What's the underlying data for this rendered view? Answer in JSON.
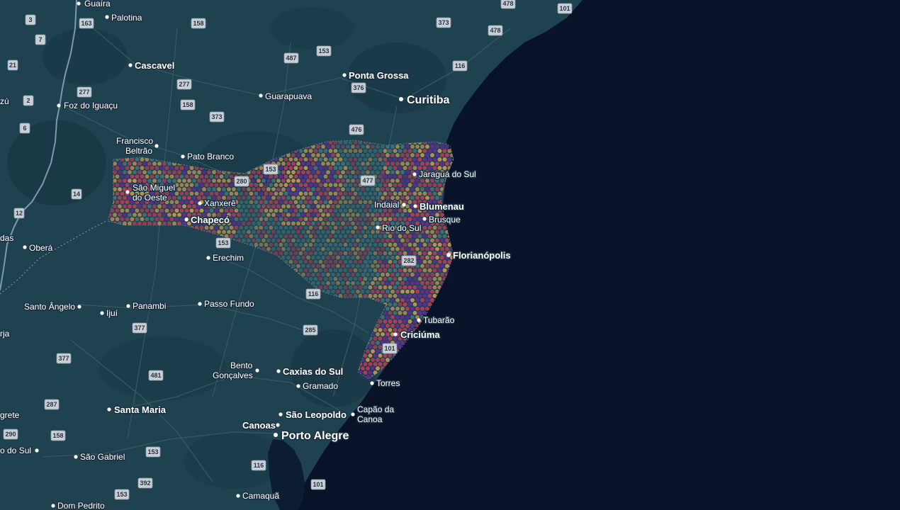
{
  "map": {
    "colors": {
      "land": "#1f4250",
      "land_dark": "#183846",
      "ocean": "#081229",
      "lagoon": "#0d1d31",
      "road": "#3d5a68",
      "river": "#7f98b0",
      "heat_low": "#d4a050",
      "heat_mid": "#c63c5a",
      "heat_high": "#6a2a9c",
      "heat_empty": "#4e7f83"
    },
    "cities": [
      {
        "name": "Guaíra",
        "size": "small"
      },
      {
        "name": "Palotina",
        "size": "small"
      },
      {
        "name": "Cascavel",
        "size": "medium"
      },
      {
        "name": "Ponta Grossa",
        "size": "medium"
      },
      {
        "name": "Curitiba",
        "size": "large"
      },
      {
        "name": "Guarapuava",
        "size": "small"
      },
      {
        "name": "zú",
        "size": "small"
      },
      {
        "name": "Foz do Iguaçu",
        "size": "small"
      },
      {
        "name": "Francisco",
        "size": "small"
      },
      {
        "name": "Beltrão",
        "size": "small"
      },
      {
        "name": "Pato Branco",
        "size": "small"
      },
      {
        "name": "Jaraguá do Sul",
        "size": "small"
      },
      {
        "name": "São Miguel",
        "size": "small"
      },
      {
        "name": "do Oeste",
        "size": "small"
      },
      {
        "name": "Xanxerê",
        "size": "small"
      },
      {
        "name": "Indaial",
        "size": "small"
      },
      {
        "name": "Blumenau",
        "size": "medium"
      },
      {
        "name": "Brusque",
        "size": "small"
      },
      {
        "name": "Chapecó",
        "size": "medium"
      },
      {
        "name": "Rio do Sul",
        "size": "small"
      },
      {
        "name": "das",
        "size": "small"
      },
      {
        "name": "Oberá",
        "size": "small"
      },
      {
        "name": "Florianópolis",
        "size": "medium"
      },
      {
        "name": "Erechim",
        "size": "small"
      },
      {
        "name": "Santo Ângelo",
        "size": "small"
      },
      {
        "name": "Ijuí",
        "size": "small"
      },
      {
        "name": "Panambi",
        "size": "small"
      },
      {
        "name": "Passo Fundo",
        "size": "small"
      },
      {
        "name": "Tubarão",
        "size": "small"
      },
      {
        "name": "rja",
        "size": "small"
      },
      {
        "name": "Criciúma",
        "size": "medium"
      },
      {
        "name": "Bento",
        "size": "small"
      },
      {
        "name": "Gonçalves",
        "size": "small"
      },
      {
        "name": "Caxias do Sul",
        "size": "medium"
      },
      {
        "name": "Torres",
        "size": "small"
      },
      {
        "name": "Gramado",
        "size": "small"
      },
      {
        "name": "Santa Maria",
        "size": "medium"
      },
      {
        "name": "São Leopoldo",
        "size": "medium"
      },
      {
        "name": "Capão da",
        "size": "small"
      },
      {
        "name": "Canoa",
        "size": "small"
      },
      {
        "name": "grete",
        "size": "small"
      },
      {
        "name": "Canoas",
        "size": "medium"
      },
      {
        "name": "Porto Alegre",
        "size": "large"
      },
      {
        "name": "o do Sul",
        "size": "small"
      },
      {
        "name": "São Gabriel",
        "size": "small"
      },
      {
        "name": "Camaquã",
        "size": "small"
      },
      {
        "name": "Dom Pedrito",
        "size": "small"
      }
    ],
    "road_shields": [
      "478",
      "101",
      "3",
      "163",
      "158",
      "373",
      "478",
      "7",
      "487",
      "153",
      "116",
      "21",
      "277",
      "376",
      "2",
      "277",
      "158",
      "373",
      "6",
      "476",
      "153",
      "280",
      "477",
      "14",
      "12",
      "153",
      "282",
      "116",
      "377",
      "285",
      "101",
      "377",
      "481",
      "287",
      "290",
      "158",
      "153",
      "116",
      "392",
      "153",
      "101"
    ]
  }
}
